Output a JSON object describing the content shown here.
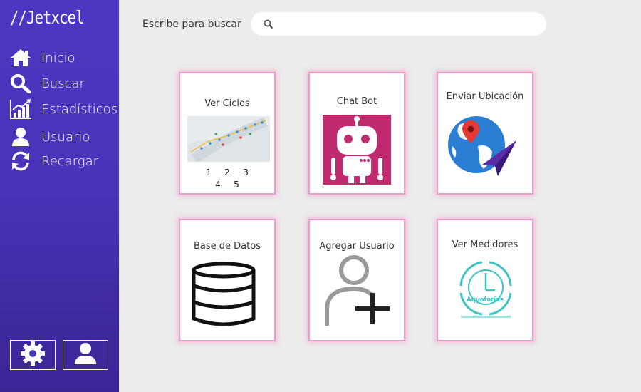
{
  "app": {
    "logo": "//Jetxcel"
  },
  "sidebar": {
    "items": [
      {
        "label": "Inicio",
        "icon": "home-icon"
      },
      {
        "label": "Buscar",
        "icon": "search-icon"
      },
      {
        "label": "Estadísticos",
        "icon": "chart-icon"
      },
      {
        "label": "Usuario",
        "icon": "user-icon"
      },
      {
        "label": "Recargar",
        "icon": "refresh-icon"
      }
    ],
    "bottom": [
      {
        "icon": "gear-icon"
      },
      {
        "icon": "user-icon"
      }
    ]
  },
  "search": {
    "label": "Escribe para buscar",
    "value": "",
    "placeholder": ""
  },
  "cards": [
    {
      "title": "Ver Ciclos",
      "pages_row1": [
        "1",
        "2",
        "3"
      ],
      "pages_row2": [
        "4",
        "5"
      ],
      "image": "map-image"
    },
    {
      "title": "Chat Bot",
      "image": "robot-icon"
    },
    {
      "title": "Enviar Ubicación",
      "image": "globe-location-icon"
    },
    {
      "title": "Base de Datos",
      "image": "database-icon"
    },
    {
      "title": "Agregar Usuario",
      "image": "add-user-icon"
    },
    {
      "title": "Ver Medidores",
      "image": "meter-clock-icon",
      "brand": "Aquaforjas"
    }
  ],
  "colors": {
    "sidebar": "#4a33b8",
    "card_border": "#f09ac7",
    "background": "#ececec",
    "robot_bg": "#c02a6e",
    "globe": "#2a7fd4",
    "meter": "#3ec3c3"
  }
}
